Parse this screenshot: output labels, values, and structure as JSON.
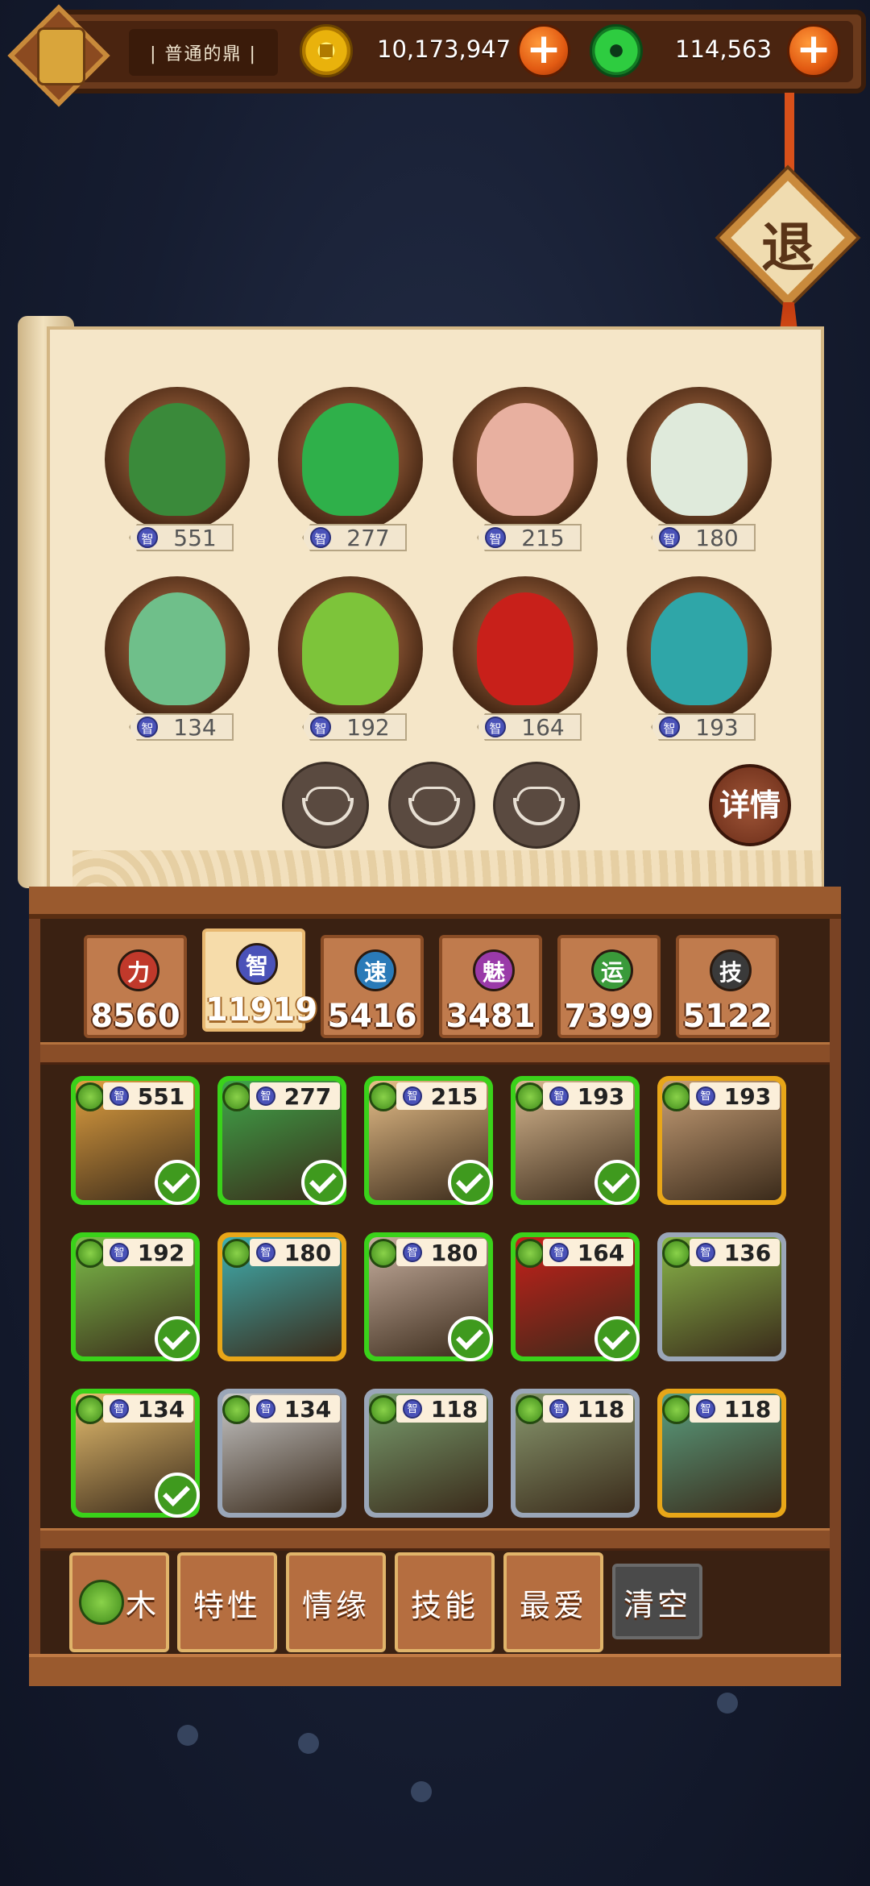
{
  "top_bar": {
    "level_label": "| 普通的鼎 |",
    "gold": "10,173,947",
    "jade": "114,563",
    "gold_plus": "+",
    "jade_plus": "+"
  },
  "exit_label": "退",
  "detail_label": "详情",
  "team": [
    {
      "iq": "551",
      "color": "#3a8a3a"
    },
    {
      "iq": "277",
      "color": "#2fb04a"
    },
    {
      "iq": "215",
      "color": "#e8b0a0"
    },
    {
      "iq": "180",
      "color": "#dfeadb"
    },
    {
      "iq": "134",
      "color": "#6fbf8a"
    },
    {
      "iq": "192",
      "color": "#7dc43a"
    },
    {
      "iq": "164",
      "color": "#c8201a"
    },
    {
      "iq": "193",
      "color": "#2fa6a8"
    }
  ],
  "iq_glyph": "智",
  "stats": [
    {
      "name": "力",
      "value": "8560",
      "color": "#c0392b"
    },
    {
      "name": "智",
      "value": "11919",
      "color": "#4a52b8"
    },
    {
      "name": "速",
      "value": "5416",
      "color": "#2a7ab8"
    },
    {
      "name": "魅",
      "value": "3481",
      "color": "#9a3aa8"
    },
    {
      "name": "运",
      "value": "7399",
      "color": "#3a9a3a"
    },
    {
      "name": "技",
      "value": "5122",
      "color": "#3a3a3a"
    }
  ],
  "selected_stat": "智",
  "cards": [
    {
      "iq": "551",
      "frame": "sel",
      "checked": true,
      "art": "#e0a040"
    },
    {
      "iq": "277",
      "frame": "sel",
      "checked": true,
      "art": "#3fa84a"
    },
    {
      "iq": "215",
      "frame": "sel",
      "checked": true,
      "art": "#e8c08a"
    },
    {
      "iq": "193",
      "frame": "sel",
      "checked": true,
      "art": "#d8b890"
    },
    {
      "iq": "193",
      "frame": "gold",
      "checked": false,
      "art": "#c8a078"
    },
    {
      "iq": "192",
      "frame": "sel",
      "checked": true,
      "art": "#7dbf4a"
    },
    {
      "iq": "180",
      "frame": "gold",
      "checked": false,
      "art": "#3fb0b0"
    },
    {
      "iq": "180",
      "frame": "sel",
      "checked": true,
      "art": "#c8b0a0"
    },
    {
      "iq": "164",
      "frame": "sel",
      "checked": true,
      "art": "#c8201a"
    },
    {
      "iq": "136",
      "frame": "silver",
      "checked": false,
      "art": "#8ab84a"
    },
    {
      "iq": "134",
      "frame": "sel",
      "checked": true,
      "art": "#e8c070"
    },
    {
      "iq": "134",
      "frame": "silver",
      "checked": false,
      "art": "#c8c8c8"
    },
    {
      "iq": "118",
      "frame": "silver",
      "checked": false,
      "art": "#7aa070"
    },
    {
      "iq": "118",
      "frame": "silver",
      "checked": false,
      "art": "#8a9a70"
    },
    {
      "iq": "118",
      "frame": "gold",
      "checked": false,
      "art": "#5aa080"
    }
  ],
  "filters": {
    "element": "木",
    "trait": "特性",
    "bond": "情缘",
    "skill": "技能",
    "favorite": "最爱",
    "clear": "清空"
  }
}
